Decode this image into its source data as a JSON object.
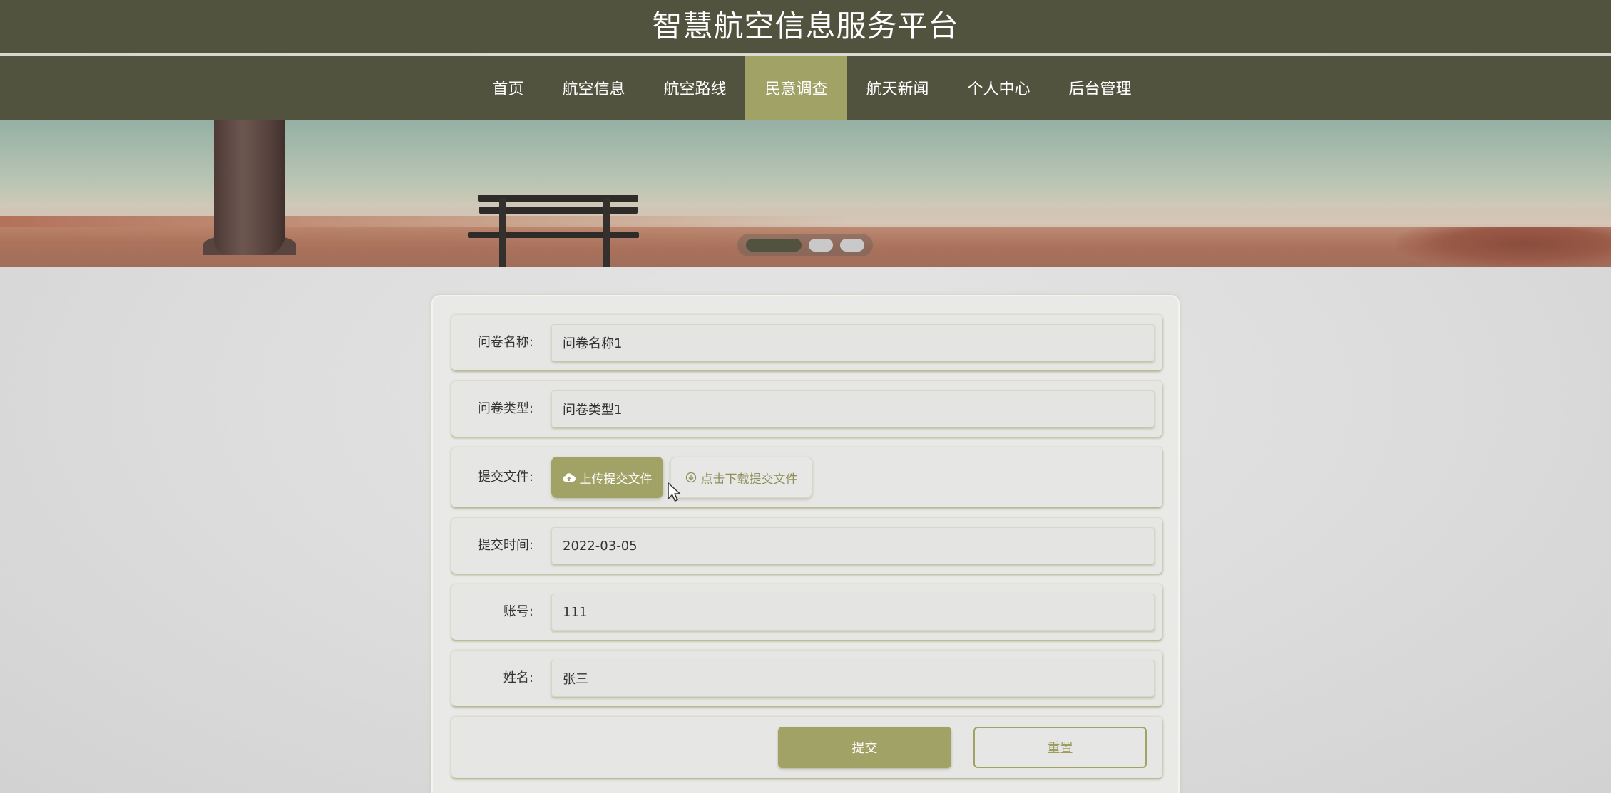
{
  "header": {
    "title": "智慧航空信息服务平台"
  },
  "nav": {
    "items": [
      {
        "label": "首页",
        "active": false
      },
      {
        "label": "航空信息",
        "active": false
      },
      {
        "label": "航空路线",
        "active": false
      },
      {
        "label": "民意调查",
        "active": true
      },
      {
        "label": "航天新闻",
        "active": false
      },
      {
        "label": "个人中心",
        "active": false
      },
      {
        "label": "后台管理",
        "active": false
      }
    ]
  },
  "banner": {
    "slides": 3,
    "active_slide": 1
  },
  "form": {
    "name_label": "问卷名称:",
    "name_value": "问卷名称1",
    "type_label": "问卷类型:",
    "type_value": "问卷类型1",
    "file_label": "提交文件:",
    "upload_label": "上传提交文件",
    "download_label": "点击下载提交文件",
    "time_label": "提交时间:",
    "time_value": "2022-03-05",
    "account_label": "账号:",
    "account_value": "111",
    "username_label": "姓名:",
    "username_value": "张三",
    "submit_label": "提交",
    "reset_label": "重置"
  },
  "colors": {
    "header_bg": "#51533e",
    "accent": "#a1a266",
    "page_bg": "#dcdcdc"
  },
  "icons": {
    "upload": "cloud-upload-icon",
    "download": "download-circle-icon"
  }
}
